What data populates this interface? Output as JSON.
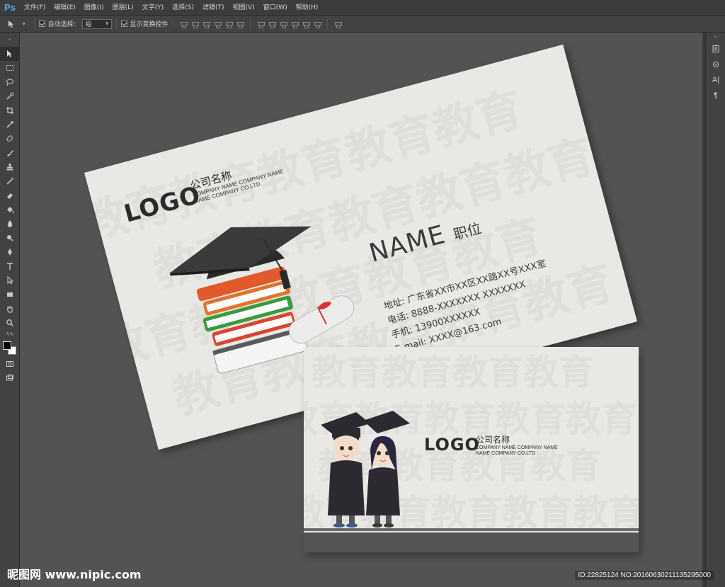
{
  "app": {
    "logo": "Ps"
  },
  "menu": [
    {
      "label": "文件(F)"
    },
    {
      "label": "编辑(E)"
    },
    {
      "label": "图像(I)"
    },
    {
      "label": "图层(L)"
    },
    {
      "label": "文字(Y)"
    },
    {
      "label": "选择(S)"
    },
    {
      "label": "滤镜(T)"
    },
    {
      "label": "视图(V)"
    },
    {
      "label": "窗口(W)"
    },
    {
      "label": "帮助(H)"
    }
  ],
  "options": {
    "auto_select_label": "自动选择：",
    "auto_select_value": "组",
    "show_transform_label": "显示变换控件",
    "auto_select_checked": true,
    "show_transform_checked": true
  },
  "colors": {
    "foreground": "#000000",
    "background": "#ffffff",
    "workspace": "#535353",
    "card": "#e9e8e5"
  },
  "front_card": {
    "logo": "LOGO",
    "company_cn": "公司名称",
    "company_en_line1": "COMPANY NAME COMPANY NAME",
    "company_en_line2": "NAME COMPANY CO.LTD",
    "name": "NAME",
    "position": "职位",
    "address": "地址: 广东省XX市XX区XX路XX号XXX室",
    "phone": "电话: 8888-XXXXXXX    XXXXXXX",
    "mobile": "手机: 13900XXXXXX",
    "email": "E-mail: XXXX@163.com",
    "pattern_word": "教育"
  },
  "back_card": {
    "logo": "LOGO",
    "company_cn": "公司名称",
    "company_en_line1": "COMPANY NAME COMPANY NAME",
    "company_en_line2": "NAME COMPANY CO.LTD",
    "pattern_word": "教育"
  },
  "watermark": {
    "site": "昵图网 www.nipic.com",
    "id": "ID:22825124 NO:20160630211135295000"
  }
}
